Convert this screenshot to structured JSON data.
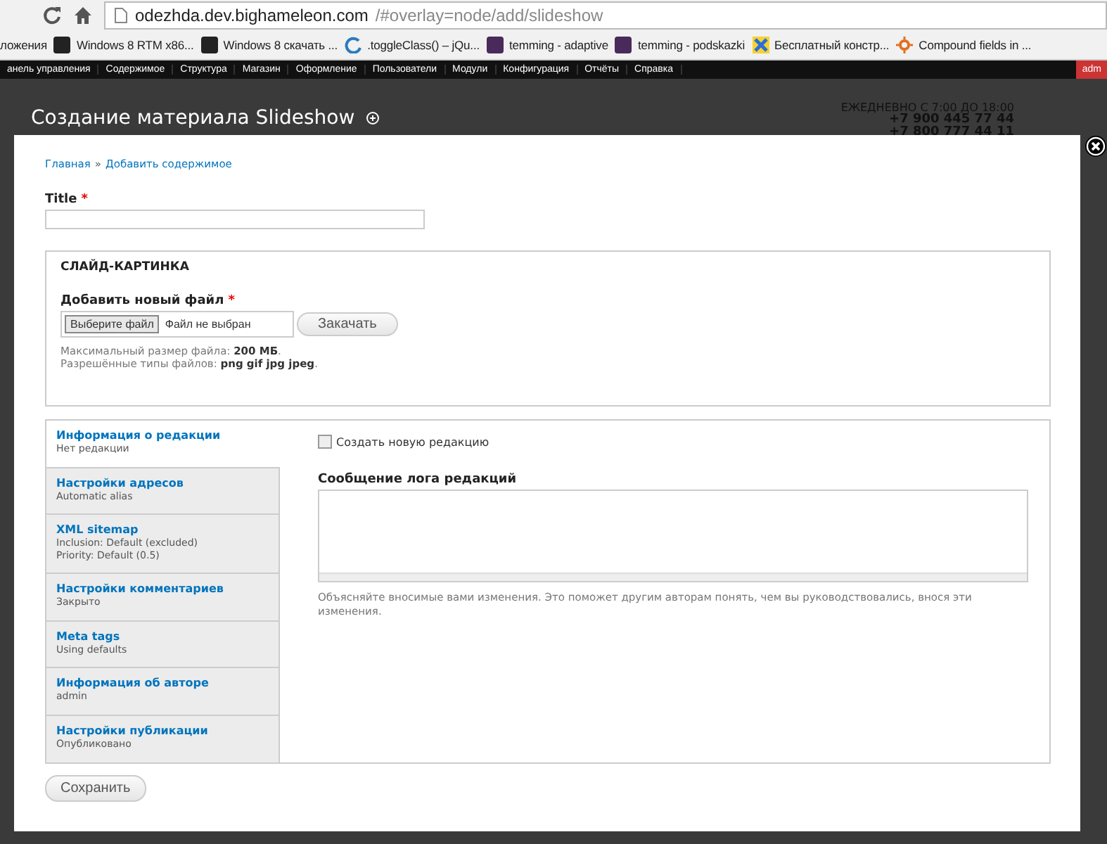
{
  "browser": {
    "url_host": "odezhda.dev.bighameleon.com",
    "url_path": "/#overlay=node/add/slideshow",
    "bookmarks": [
      {
        "label": "ложения",
        "kind": "none"
      },
      {
        "label": "Windows 8 RTM x86...",
        "kind": "t"
      },
      {
        "label": "Windows 8 скачать ...",
        "kind": "t"
      },
      {
        "label": ".toggleClass() – jQu...",
        "kind": "swirl"
      },
      {
        "label": "temming - adaptive",
        "kind": "b"
      },
      {
        "label": "temming - podskazki",
        "kind": "b"
      },
      {
        "label": "Бесплатный констр...",
        "kind": "x"
      },
      {
        "label": "Compound fields in ...",
        "kind": "sun"
      }
    ]
  },
  "admin_toolbar": {
    "items": [
      "анель управления",
      "Содержимое",
      "Структура",
      "Магазин",
      "Оформление",
      "Пользователи",
      "Модули",
      "Конфигурация",
      "Отчёты",
      "Справка"
    ],
    "user": "adm"
  },
  "background_site": {
    "hours": "ЕЖЕДНЕВНО С 7:00 ДО 18:00",
    "phones": [
      "+7 900 445 77 44",
      "+7 800 777 44 11"
    ]
  },
  "overlay": {
    "title": "Создание материала Slideshow",
    "breadcrumb": [
      "Главная",
      "Добавить содержимое"
    ],
    "breadcrumb_separator": "»",
    "title_field": {
      "label": "Title",
      "required": true,
      "required_mark": "*"
    },
    "fieldset": {
      "legend": "СЛАЙД-КАРТИНКА",
      "file_label": "Добавить новый файл",
      "required": true,
      "required_mark": "*",
      "choose_button": "Выберите файл",
      "no_file": "Файл не выбран",
      "upload_button": "Закачать",
      "help": [
        "Максимальный размер файла: **200 МБ**.",
        "Разрешённые типы файлов: **png gif jpg jpeg**."
      ]
    },
    "vertical_tabs": [
      {
        "title": "Информация о редакции",
        "summary": [
          "Нет редакции"
        ],
        "selected": true
      },
      {
        "title": "Настройки адресов",
        "summary": [
          "Automatic alias"
        ],
        "selected": false
      },
      {
        "title": "XML sitemap",
        "summary": [
          "Inclusion: Default (excluded)",
          "Priority: Default (0.5)"
        ],
        "selected": false
      },
      {
        "title": "Настройки комментариев",
        "summary": [
          "Закрыто"
        ],
        "selected": false
      },
      {
        "title": "Meta tags",
        "summary": [
          "Using defaults"
        ],
        "selected": false
      },
      {
        "title": "Информация об авторе",
        "summary": [
          "admin"
        ],
        "selected": false
      },
      {
        "title": "Настройки публикации",
        "summary": [
          "Опубликовано"
        ],
        "selected": false
      }
    ],
    "revision": {
      "checkbox_label": "Создать новую редакцию",
      "checked": false,
      "log_label": "Сообщение лога редакций",
      "help": "Объясняйте вносимые вами изменения. Это поможет другим авторам понять, чем вы руководствовались, внося эти изменения."
    },
    "save_button": "Сохранить"
  }
}
